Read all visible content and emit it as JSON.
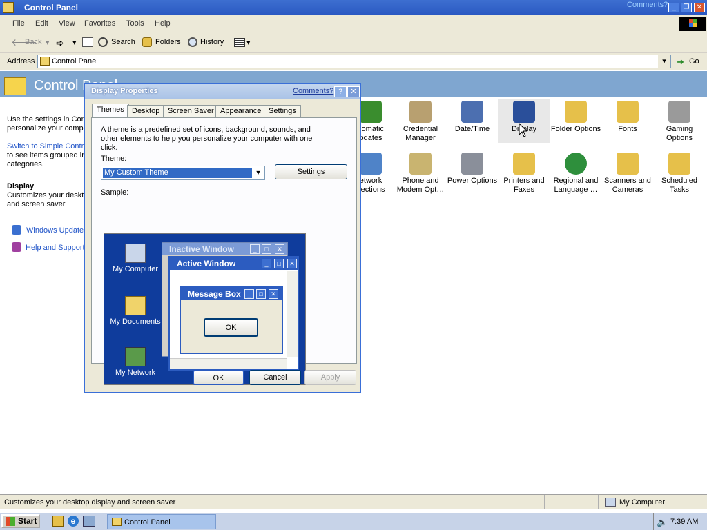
{
  "window": {
    "title": "Control Panel",
    "comments_link": "Comments?",
    "minimize": "_",
    "restore": "❐",
    "close": "✕"
  },
  "menu": [
    "File",
    "Edit",
    "View",
    "Favorites",
    "Tools",
    "Help"
  ],
  "toolbar": {
    "back": "Back",
    "forward": "",
    "search": "Search",
    "folders": "Folders",
    "history": "History"
  },
  "address": {
    "label": "Address",
    "value": "Control Panel",
    "go": "Go"
  },
  "left_panel": {
    "header": "Control Panel",
    "intro_line1": "Use the settings in Con",
    "intro_line2": "personalize your compu",
    "switch_link": "Switch to Simple Contro",
    "switch_line2": "to see items grouped in",
    "switch_line3": "categories.",
    "display_heading": "Display",
    "display_desc1": "Customizes your deskto",
    "display_desc2": "and screen saver",
    "links": [
      "Windows Update",
      "Help and Support"
    ]
  },
  "icons": [
    {
      "line1": "comatic",
      "line2": "pdates",
      "color": "#3a8d2e"
    },
    {
      "line1": "Credential",
      "line2": "Manager",
      "color": "#b8a070"
    },
    {
      "line1": "Date/Time",
      "line2": "",
      "color": "#4c6fb0"
    },
    {
      "line1": "Display",
      "line2": "",
      "color": "#2a4f9a"
    },
    {
      "line1": "Folder Options",
      "line2": "",
      "color": "#e6c04a"
    },
    {
      "line1": "Fonts",
      "line2": "",
      "color": "#e6c04a"
    },
    {
      "line1": "Gaming",
      "line2": "Options",
      "color": "#9a9a9a"
    },
    {
      "line1": "etwork",
      "line2": "nections",
      "color": "#4f83c8"
    },
    {
      "line1": "Phone and",
      "line2": "Modem Opt…",
      "color": "#c9b470"
    },
    {
      "line1": "Power Options",
      "line2": "",
      "color": "#8a8f9a"
    },
    {
      "line1": "Printers and",
      "line2": "Faxes",
      "color": "#e6c04a"
    },
    {
      "line1": "Regional and",
      "line2": "Language …",
      "color": "#2e8f3c"
    },
    {
      "line1": "Scanners and",
      "line2": "Cameras",
      "color": "#e6c04a"
    },
    {
      "line1": "Scheduled",
      "line2": "Tasks",
      "color": "#e6c04a"
    }
  ],
  "dialog": {
    "title": "Display Properties",
    "comments": "Comments?",
    "help": "?",
    "close": "✕",
    "tabs": [
      "Themes",
      "Desktop",
      "Screen Saver",
      "Appearance",
      "Settings"
    ],
    "description": "A theme is a predefined set of icons, background, sounds, and other elements to help you personalize your computer with one click.",
    "theme_label": "Theme:",
    "theme_value": "My Custom Theme",
    "settings_button": "Settings",
    "sample_label": "Sample:",
    "ok": "OK",
    "cancel": "Cancel",
    "apply": "Apply"
  },
  "sample": {
    "desktop_icons": [
      "My Computer",
      "My Documents",
      "My Network"
    ],
    "inactive_window": "Inactive Window",
    "active_window": "Active Window",
    "message_box": "Message Box",
    "message_ok": "OK"
  },
  "status": {
    "text": "Customizes your desktop display and screen saver",
    "zone": "My Computer"
  },
  "taskbar": {
    "start": "Start",
    "task": "Control Panel",
    "time": "7:39 AM"
  }
}
